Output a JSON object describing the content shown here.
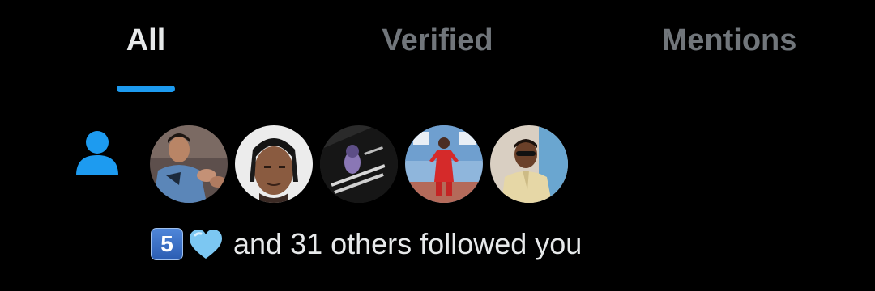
{
  "tabs": [
    {
      "label": "All",
      "active": true
    },
    {
      "label": "Verified",
      "active": false
    },
    {
      "label": "Mentions",
      "active": false
    }
  ],
  "colors": {
    "background": "#000000",
    "accent": "#1d9bf0",
    "active_text": "#e7e9ea",
    "inactive_text": "#71767b",
    "divider": "#2f3336"
  },
  "notification": {
    "type_icon": "person-icon",
    "avatars": [
      {
        "name": "avatar-1"
      },
      {
        "name": "avatar-2"
      },
      {
        "name": "avatar-3"
      },
      {
        "name": "avatar-4"
      },
      {
        "name": "avatar-5"
      }
    ],
    "emoji_badge": "5",
    "emoji_heart": "blue-heart-icon",
    "message": "and 31 others followed you"
  }
}
